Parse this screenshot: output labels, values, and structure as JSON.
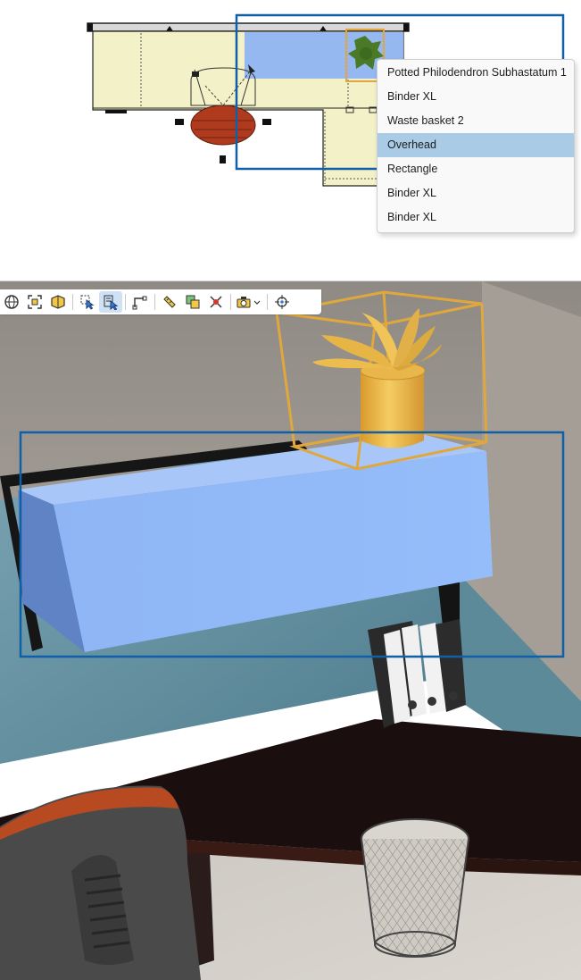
{
  "context_menu": {
    "items": [
      {
        "label": "Potted Philodendron Subhastatum 1",
        "active": false
      },
      {
        "label": "Binder XL",
        "active": false
      },
      {
        "label": "Waste basket 2",
        "active": false
      },
      {
        "label": "Overhead",
        "active": true
      },
      {
        "label": "Rectangle",
        "active": false
      },
      {
        "label": "Binder XL",
        "active": false
      },
      {
        "label": "Binder XL",
        "active": false
      }
    ]
  },
  "toolbar": {
    "buttons": [
      {
        "name": "orbit-icon",
        "pressed": false
      },
      {
        "name": "zoom-extents-icon",
        "pressed": false
      },
      {
        "name": "zoom-selection-icon",
        "pressed": false
      },
      {
        "name": "select-icon",
        "pressed": false
      },
      {
        "name": "select-edit-icon",
        "pressed": true
      },
      {
        "name": "section-icon",
        "pressed": false
      },
      {
        "name": "measure-icon",
        "pressed": false
      },
      {
        "name": "copy-object-icon",
        "pressed": false
      },
      {
        "name": "remove-icon",
        "pressed": false
      },
      {
        "name": "camera-dropdown-icon",
        "pressed": false
      },
      {
        "name": "center-target-icon",
        "pressed": false
      }
    ]
  },
  "colors": {
    "selection_box": "#1060a8",
    "highlight_blue": "#8fb4f2",
    "menu_active": "#a9cbe6",
    "object_highlight": "#e8b64a",
    "desk_top_plan": "#f3f1c8",
    "panel_teal": "#5f8fa0",
    "wall_grey": "#9c958c",
    "desk_dark": "#1a0e0e"
  }
}
